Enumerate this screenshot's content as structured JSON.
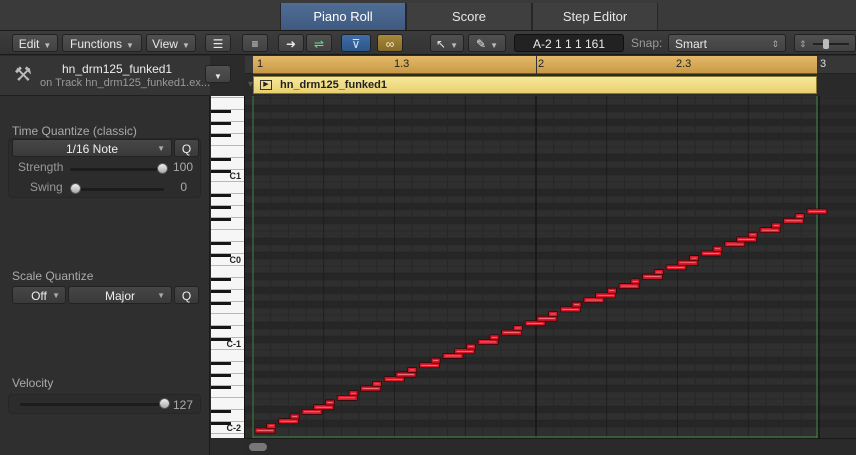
{
  "tabs": [
    {
      "label": "Piano Roll",
      "active": true
    },
    {
      "label": "Score",
      "active": false
    },
    {
      "label": "Step Editor",
      "active": false
    }
  ],
  "toolbar": {
    "edit_label": "Edit",
    "functions_label": "Functions",
    "view_label": "View",
    "position_display": "A-2  1 1 1 161",
    "snap_label": "Snap:",
    "snap_value": "Smart"
  },
  "inspector": {
    "region_name": "hn_drm125_funked1",
    "track_text": "on Track hn_drm125_funked1.ex...",
    "time_quantize": {
      "title": "Time Quantize (classic)",
      "value": "1/16 Note",
      "q_label": "Q",
      "strength_label": "Strength",
      "strength_value": "100",
      "strength_level": 1.0,
      "swing_label": "Swing",
      "swing_value": "0",
      "swing_level": 0.0
    },
    "scale_quantize": {
      "title": "Scale Quantize",
      "root_value": "Off",
      "scale_value": "Major",
      "q_label": "Q"
    },
    "velocity": {
      "title": "Velocity",
      "value": "127",
      "level": 1.0
    }
  },
  "ruler": {
    "labels": [
      "1",
      "1.3",
      "2",
      "2.3",
      "3"
    ]
  },
  "region": {
    "name": "hn_drm125_funked1"
  },
  "keyboard": {
    "labels": [
      "C1",
      "C0",
      "C-1",
      "C-2"
    ]
  },
  "notes_count": 48,
  "colors": {
    "note_fill": "#d8192a",
    "cycle": "#d9aa55",
    "region_header": "#f3e08a",
    "active_tab": "#4a6890"
  }
}
